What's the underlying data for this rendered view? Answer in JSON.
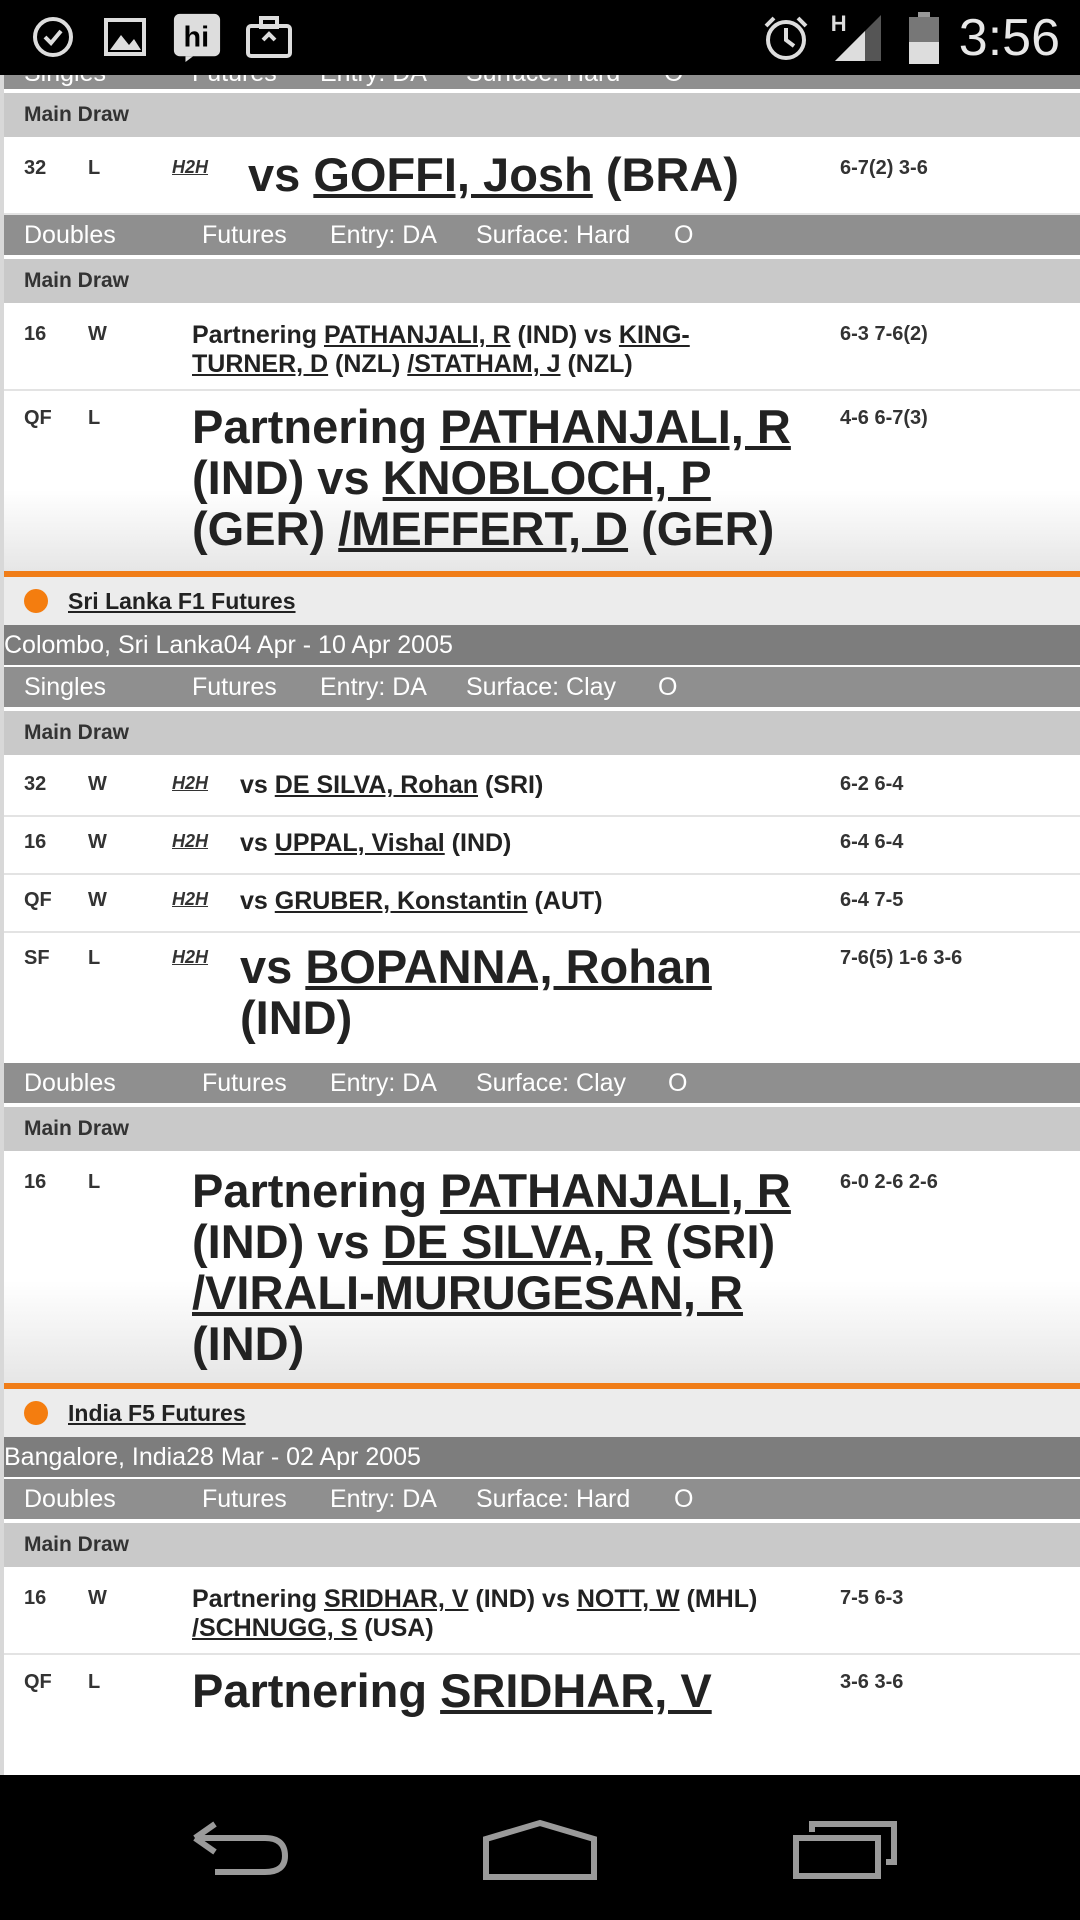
{
  "status_bar": {
    "time": "3:56",
    "network": "H",
    "left_icons": [
      "sync-icon",
      "gallery-icon",
      "hike-icon",
      "briefcase-icon"
    ],
    "right_icons": [
      "alarm-icon",
      "signal-icon",
      "battery-icon"
    ]
  },
  "events": [
    {
      "blocks": [
        {
          "category": {
            "type": "Singles",
            "level": "Futures",
            "entry": "Entry: DA",
            "surface": "Surface: Hard",
            "extra": "O"
          },
          "draw": "Main Draw",
          "matches": [
            {
              "round": "32",
              "result": "L",
              "h2h": "H2H",
              "prefix": "vs ",
              "opponent": "GOFFI, Josh",
              "country": " (BRA)",
              "score": "6-7(2) 3-6"
            }
          ]
        },
        {
          "category": {
            "type": "Doubles",
            "level": "Futures",
            "entry": "Entry: DA",
            "surface": "Surface: Hard",
            "extra": "O"
          },
          "draw": "Main Draw",
          "matches": [
            {
              "round": "16",
              "result": "W",
              "partnering": "Partnering ",
              "partner": "PATHANJALI, R",
              "partner_country": " (IND) vs ",
              "opp1": "KING-TURNER, D",
              "opp1_country": " (NZL) ",
              "opp2": "/STATHAM, J",
              "opp2_country": " (NZL)",
              "score": "6-3 7-6(2)"
            },
            {
              "round": "QF",
              "result": "L",
              "partnering": "Partnering ",
              "partner": "PATHANJALI, R",
              "partner_country": " (IND) vs ",
              "opp1": "KNOBLOCH, P",
              "opp1_country": " (GER) ",
              "opp2": "/MEFFERT, D",
              "opp2_country": " (GER)",
              "score": "4-6 6-7(3)"
            }
          ]
        }
      ]
    },
    {
      "name": "Sri Lanka F1 Futures",
      "location": "Colombo, Sri Lanka",
      "dates": "04 Apr - 10 Apr 2005",
      "blocks": [
        {
          "category": {
            "type": "Singles",
            "level": "Futures",
            "entry": "Entry: DA",
            "surface": "Surface: Clay",
            "extra": "O"
          },
          "draw": "Main Draw",
          "matches": [
            {
              "round": "32",
              "result": "W",
              "h2h": "H2H",
              "prefix": "vs ",
              "opponent": "DE SILVA, Rohan",
              "country": " (SRI)",
              "score": "6-2 6-4"
            },
            {
              "round": "16",
              "result": "W",
              "h2h": "H2H",
              "prefix": "vs ",
              "opponent": "UPPAL, Vishal",
              "country": " (IND)",
              "score": "6-4 6-4"
            },
            {
              "round": "QF",
              "result": "W",
              "h2h": "H2H",
              "prefix": "vs ",
              "opponent": "GRUBER, Konstantin",
              "country": " (AUT)",
              "score": "6-4 7-5"
            },
            {
              "round": "SF",
              "result": "L",
              "h2h": "H2H",
              "prefix": "vs ",
              "opponent": "BOPANNA, Rohan",
              "country": " (IND)",
              "score": "7-6(5) 1-6 3-6"
            }
          ]
        },
        {
          "category": {
            "type": "Doubles",
            "level": "Futures",
            "entry": "Entry: DA",
            "surface": "Surface: Clay",
            "extra": "O"
          },
          "draw": "Main Draw",
          "matches": [
            {
              "round": "16",
              "result": "L",
              "partnering": "Partnering ",
              "partner": "PATHANJALI, R",
              "partner_country": " (IND) vs ",
              "opp1": "DE SILVA, R",
              "opp1_country": " (SRI) ",
              "opp2": "/VIRALI-MURUGESAN, R",
              "opp2_country": " (IND)",
              "score": "6-0 2-6 2-6"
            }
          ]
        }
      ]
    },
    {
      "name": "India F5 Futures",
      "location": "Bangalore, India",
      "dates": "28 Mar - 02 Apr 2005",
      "blocks": [
        {
          "category": {
            "type": "Doubles",
            "level": "Futures",
            "entry": "Entry: DA",
            "surface": "Surface: Hard",
            "extra": "O"
          },
          "draw": "Main Draw",
          "matches": [
            {
              "round": "16",
              "result": "W",
              "partnering": "Partnering ",
              "partner": "SRIDHAR, V",
              "partner_country": " (IND) vs ",
              "opp1": "NOTT, W",
              "opp1_country": " (MHL) ",
              "opp2": "/SCHNUGG, S",
              "opp2_country": " (USA)",
              "score": "7-5 6-3"
            },
            {
              "round": "QF",
              "result": "L",
              "partnering": "Partnering ",
              "partner": "SRIDHAR, V",
              "score": "3-6 3-6"
            }
          ]
        }
      ]
    }
  ],
  "nav_bar": {
    "icons": [
      "back-icon",
      "home-icon",
      "recent-apps-icon"
    ]
  }
}
